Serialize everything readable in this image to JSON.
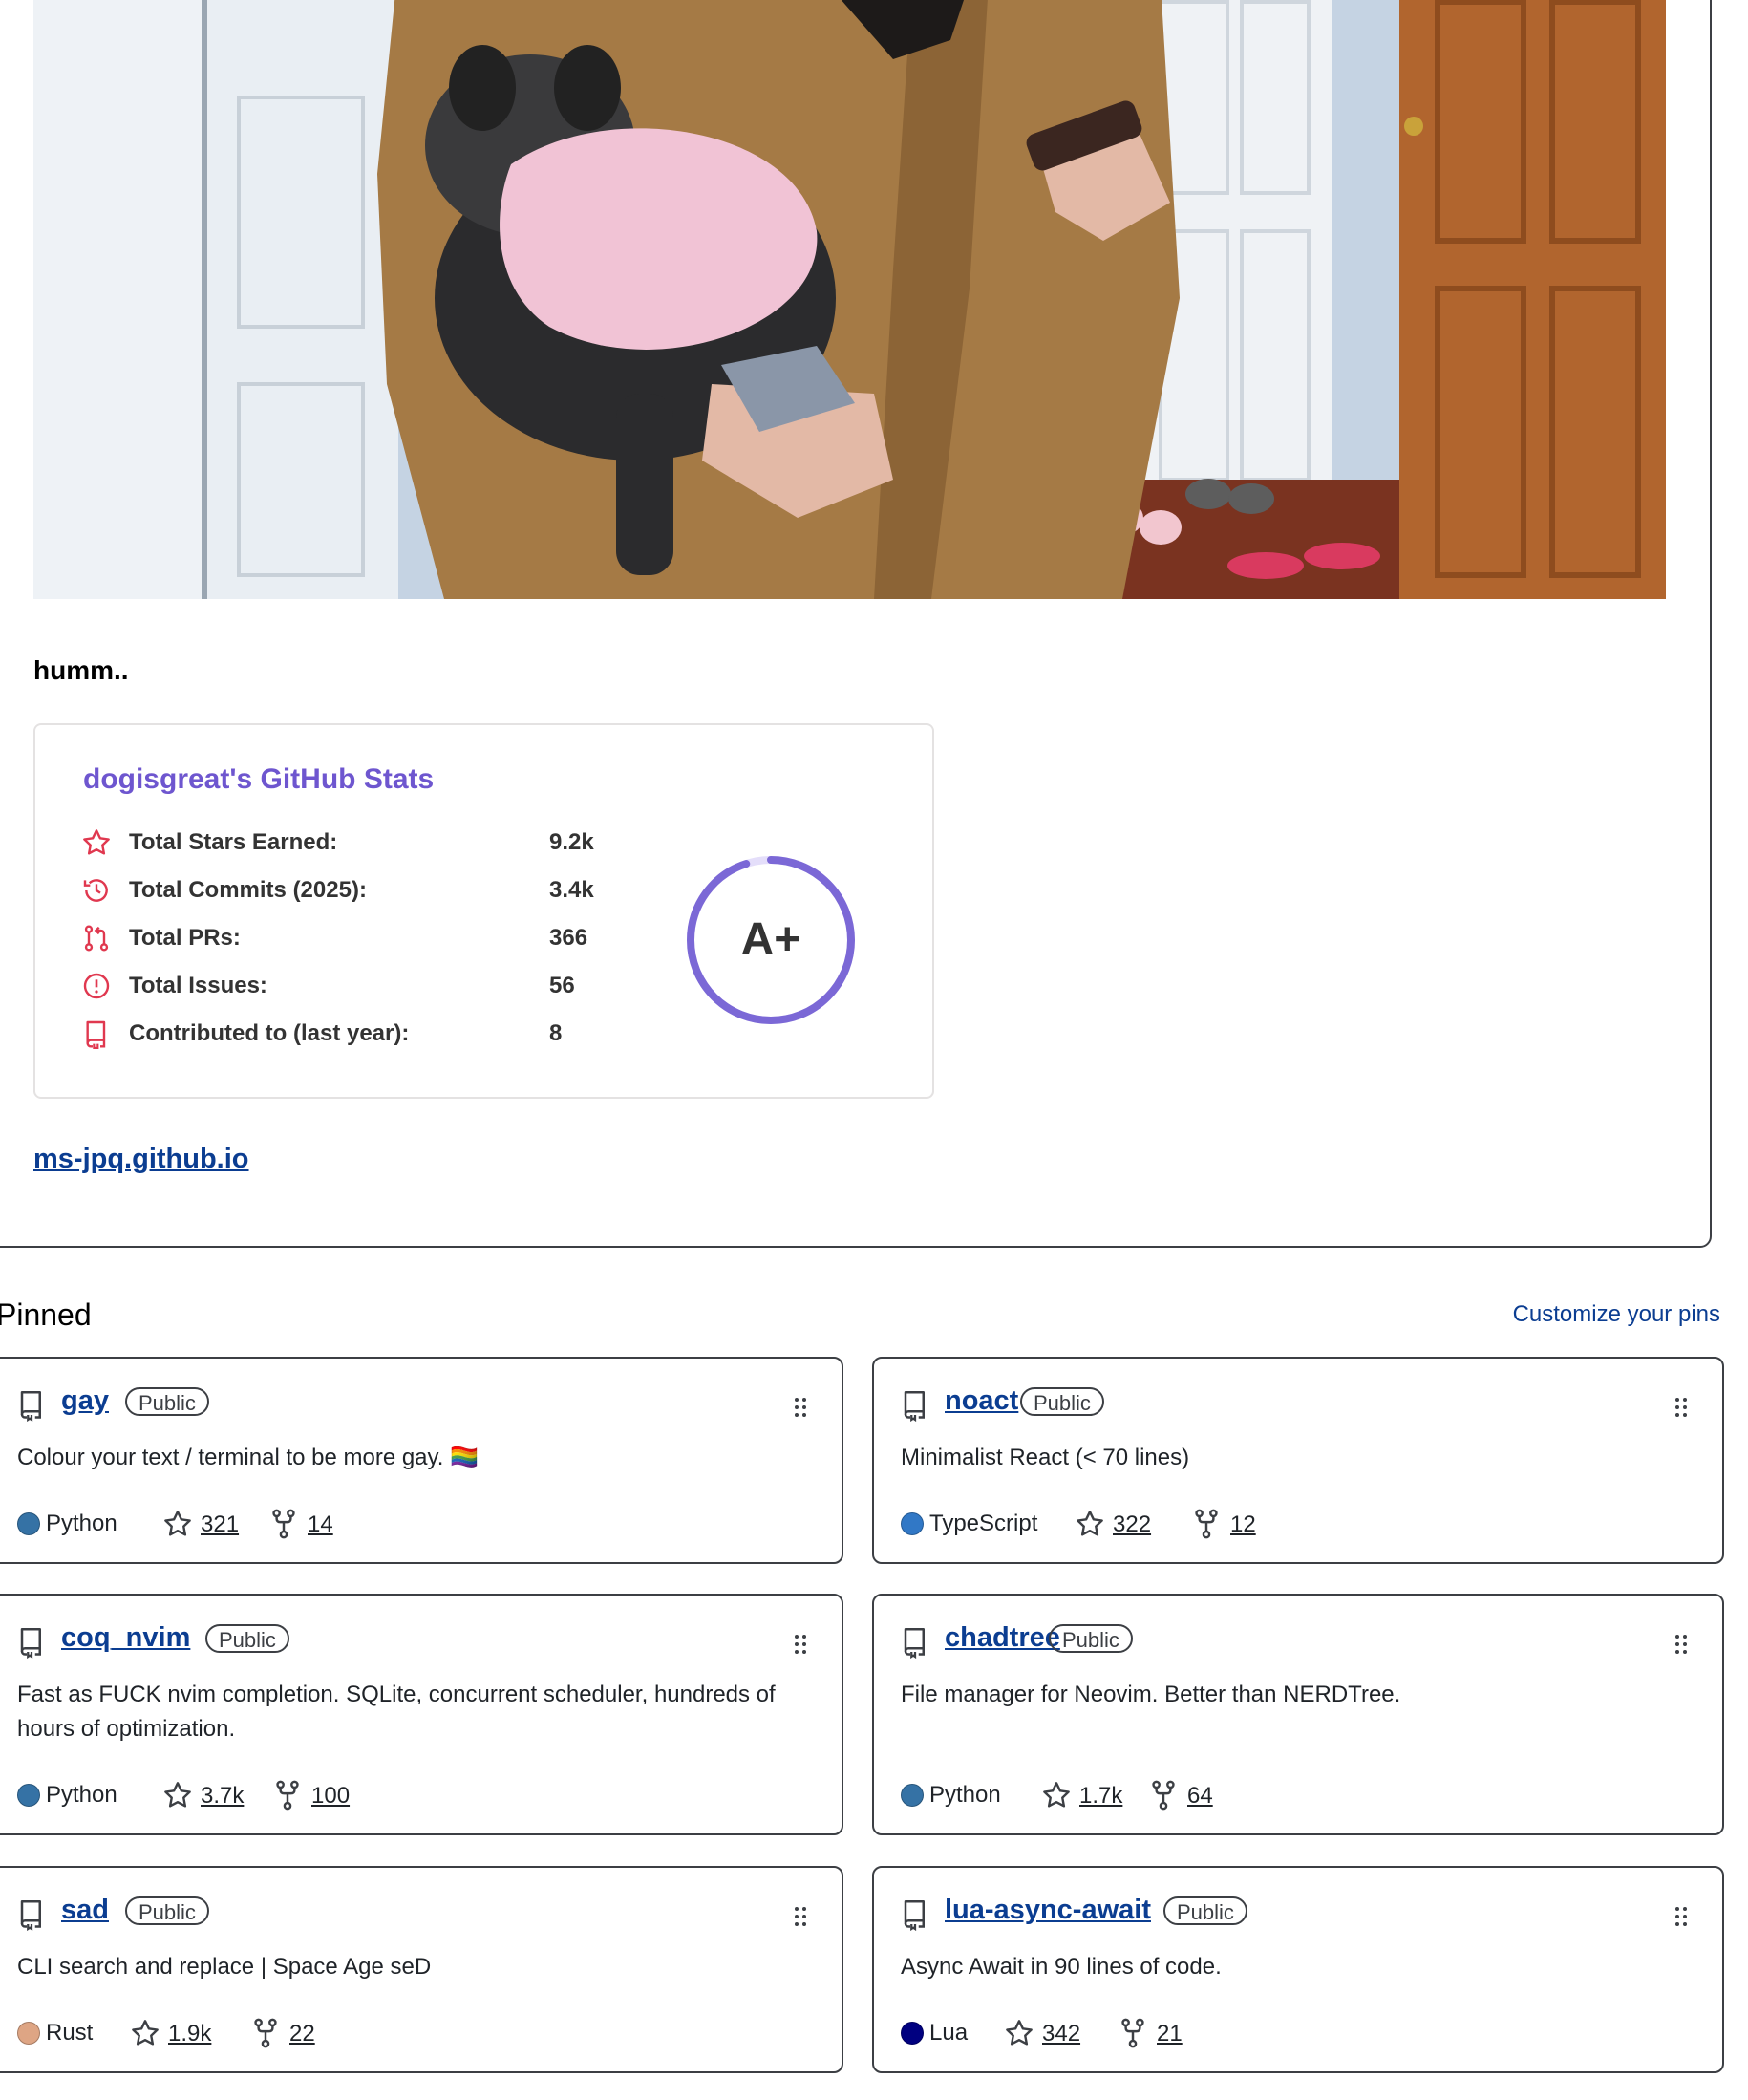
{
  "readme": {
    "heading": "humm..",
    "link": "ms-jpq.github.io"
  },
  "stats_card": {
    "title": "dogisgreat's GitHub Stats",
    "rows": [
      {
        "label": "Total Stars Earned:",
        "value": "9.2k",
        "icon": "star-icon"
      },
      {
        "label": "Total Commits (2025):",
        "value": "3.4k",
        "icon": "history-icon"
      },
      {
        "label": "Total PRs:",
        "value": "366",
        "icon": "pull-request-icon"
      },
      {
        "label": "Total Issues:",
        "value": "56",
        "icon": "issue-icon"
      },
      {
        "label": "Contributed to (last year):",
        "value": "8",
        "icon": "repo-icon"
      }
    ],
    "rank": "A+",
    "rank_progress": 0.95,
    "accent_color": "#6e56cf",
    "icon_color": "#e0384f"
  },
  "pinned": {
    "title": "Pinned",
    "customize_label": "Customize your pins",
    "repos": [
      {
        "name": "gay",
        "visibility": "Public",
        "description": "Colour your text / terminal to be more gay. 🏳️‍🌈",
        "language": "Python",
        "language_color": "#3572A5",
        "stars": "321",
        "forks": "14"
      },
      {
        "name": "noact",
        "visibility": "Public",
        "description": "Minimalist React (< 70 lines)",
        "language": "TypeScript",
        "language_color": "#3178c6",
        "stars": "322",
        "forks": "12"
      },
      {
        "name": "coq_nvim",
        "visibility": "Public",
        "description": "Fast as FUCK nvim completion. SQLite, concurrent scheduler, hundreds of hours of optimization.",
        "language": "Python",
        "language_color": "#3572A5",
        "stars": "3.7k",
        "forks": "100"
      },
      {
        "name": "chadtree",
        "visibility": "Public",
        "description": "File manager for Neovim. Better than NERDTree.",
        "language": "Python",
        "language_color": "#3572A5",
        "stars": "1.7k",
        "forks": "64"
      },
      {
        "name": "sad",
        "visibility": "Public",
        "description": "CLI search and replace | Space Age seD",
        "language": "Rust",
        "language_color": "#dea584",
        "stars": "1.9k",
        "forks": "22"
      },
      {
        "name": "lua-async-await",
        "visibility": "Public",
        "description": "Async Await in 90 lines of code.",
        "language": "Lua",
        "language_color": "#000080",
        "stars": "342",
        "forks": "21"
      }
    ]
  }
}
